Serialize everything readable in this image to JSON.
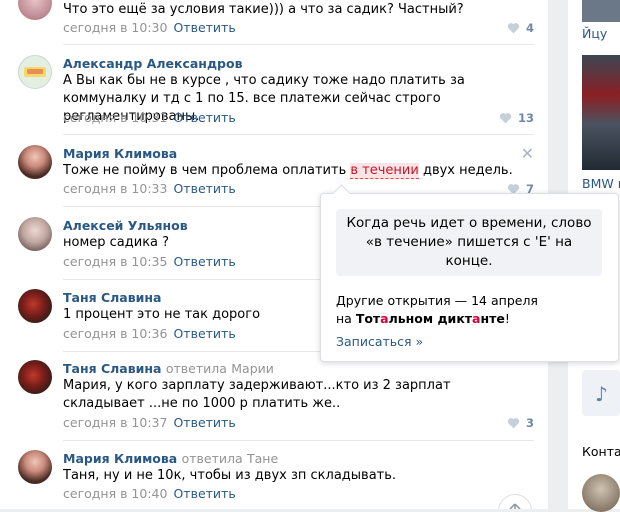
{
  "comments": [
    {
      "text": "Что это ещё за условия такие))) а что за садик? Частный?",
      "time": "сегодня в 10:30",
      "reply_label": "Ответить",
      "likes": "4"
    },
    {
      "author": "Александр Александров",
      "text": "А Вы как бы не в курсе , что садику тоже надо платить за коммуналку и тд с 1 по 15. все платежи сейчас строго регламентированы.",
      "time": "сегодня в 10:31",
      "reply_label": "Ответить",
      "likes": "13"
    },
    {
      "author": "Мария Климова",
      "text_before": "Тоже не пойму в чем проблема оплатить ",
      "text_highlight": "в течении",
      "text_after": " двух недель.",
      "time": "сегодня в 10:33",
      "reply_label": "Ответить",
      "likes": "7"
    },
    {
      "author": "Алексей Ульянов",
      "text": "номер садика ?",
      "time": "сегодня в 10:35",
      "reply_label": "Ответить"
    },
    {
      "author": "Таня Славина",
      "text": "1 процент это не так дорого",
      "time": "сегодня в 10:36",
      "reply_label": "Ответить"
    },
    {
      "author": "Таня Славина",
      "reply_to_word": "ответила",
      "reply_to_name": "Марии",
      "text": "Мария, у кого зарплату задерживают...кто из 2 зарплат складывает ...не по 1000 р платить же..",
      "time": "сегодня в 10:37",
      "reply_label": "Ответить",
      "likes": "3"
    },
    {
      "author": "Мария Климова",
      "reply_to_word": "ответила",
      "reply_to_name": "Тане",
      "text": "Таня, ну и не 10к, чтобы из двух зп складывать.",
      "time": "сегодня в 10:40",
      "reply_label": "Ответить"
    }
  ],
  "tooltip": {
    "message": "Когда речь идет о времени, слово «в течение» пишется с 'Е' на конце.",
    "next_line1": "Другие открытия — 14 апреля",
    "next_prefix": "на ",
    "dictant_part1": "Тот",
    "dictant_red1": "а",
    "dictant_part2": "льном дикт",
    "dictant_red2": "а",
    "dictant_part3": "нте",
    "next_suffix": "!",
    "signup_link": "Записаться »"
  },
  "sidebar": {
    "ad_caption_1": "Йцу",
    "ad_caption_2": "BMW г",
    "contacts_label": "Конта"
  },
  "colors": {
    "link": "#2a5885",
    "meta": "#939393",
    "highlight_bg": "#fbe4e6",
    "highlight_text": "#c3182c"
  }
}
